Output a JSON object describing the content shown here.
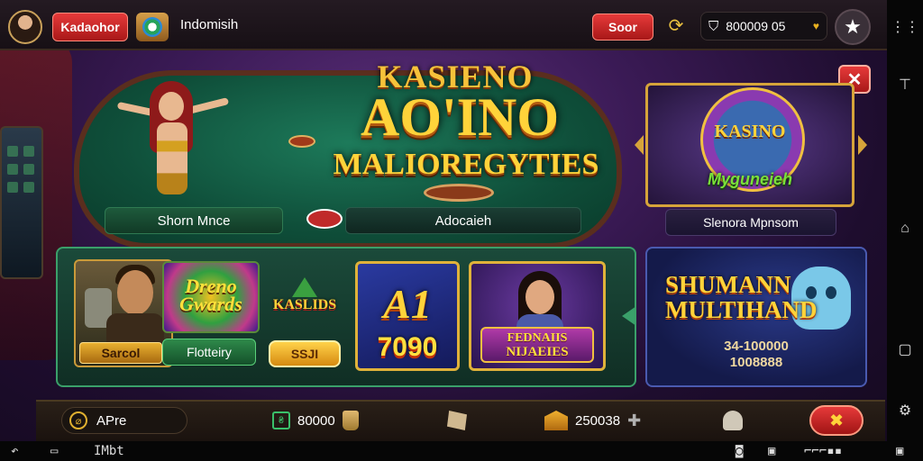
{
  "topbar": {
    "primary_button": "Kadaohor",
    "region": "Indomisih",
    "action_button": "Soor",
    "balance": "800009 05"
  },
  "promo": {
    "logo_top": "KASIENO",
    "logo_main": "AO'INO",
    "logo_sub": "MALIOREGYTIES",
    "left_pill": "Shorn Mnce",
    "mid_pill": "Adocaieh",
    "side_card_title": "KASINO",
    "side_card_sub": "Myguneieh",
    "side_pill": "Slenora Mpnsom"
  },
  "games": {
    "man_label": "Sarcol",
    "fortune_title": "Dreno Gwards",
    "fortune_tag": "Flotteiry",
    "kaslids_title": "KASLIDS",
    "kaslids_tag": "SSJI",
    "a1_title": "A1",
    "a1_number": "7090",
    "lady_line1": "FEDNAIIS",
    "lady_line2": "NIJAEIES"
  },
  "feature": {
    "title_line1": "SHUMANN",
    "title_line2": "MULTIHAND",
    "amount_line1": "34-100000",
    "amount_line2": "1008888"
  },
  "bottombar": {
    "apre_label": "APre",
    "coins": "80000",
    "gems": "250038"
  },
  "system_bar": {
    "app_label": "IMbt"
  },
  "colors": {
    "accent_red": "#d32a2a",
    "accent_gold": "#ffd33a",
    "table_green": "#1d7a5a",
    "panel_border_green": "#3aa06a"
  },
  "icons": [
    "player-avatar-icon",
    "coin-icon",
    "refresh-icon",
    "shield-icon",
    "heart-icon",
    "star-icon",
    "close-icon",
    "user-icon",
    "chest-icon"
  ]
}
